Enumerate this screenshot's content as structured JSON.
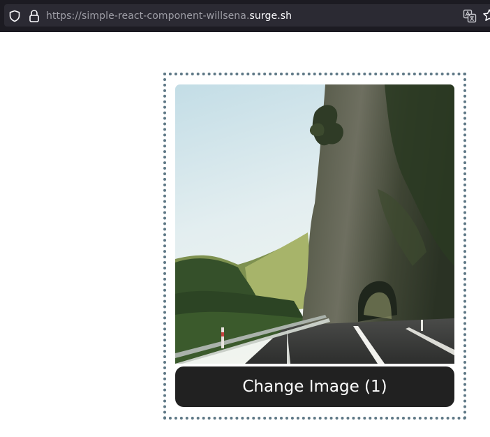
{
  "browser": {
    "url_prefix": "https://simple-react-component-willsena.",
    "url_domain": "surge.sh",
    "icons": [
      "shield-icon",
      "lock-icon",
      "translate-icon",
      "star-icon"
    ]
  },
  "main": {
    "image": {
      "subject": "road-tunnel-through-cliff-photo"
    },
    "change_button_label": "Change Image (1)"
  },
  "colors": {
    "browser_bar": "#1c1b22",
    "url_field": "#2b2a33",
    "frame_border": "#5d7785",
    "button_bg": "#212121",
    "button_text": "#ffffff"
  }
}
